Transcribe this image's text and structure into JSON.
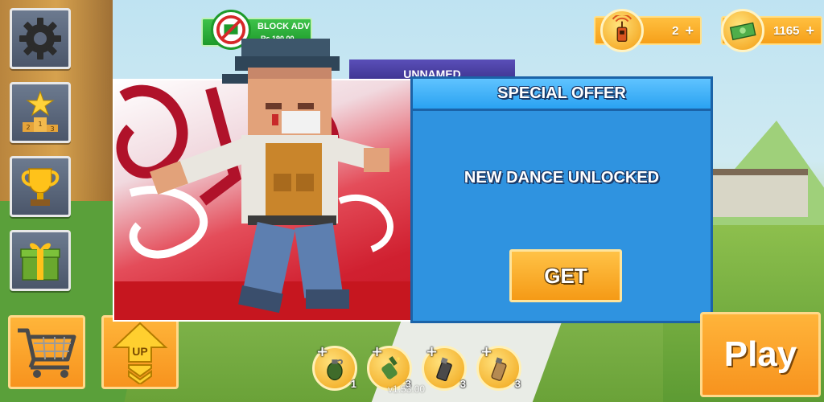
{
  "top": {
    "block_adv": {
      "title": "BLOCK ADV",
      "price": "Rs 190.00"
    },
    "signals": {
      "value": "2",
      "plus": "+"
    },
    "cash": {
      "value": "1165",
      "plus": "+"
    }
  },
  "character_panel": {
    "name_tab": "UNNAMED"
  },
  "offer_dialog": {
    "title": "SPECIAL OFFER",
    "message": "NEW DANCE UNLOCKED",
    "get_label": "GET"
  },
  "bottom": {
    "upgrade_label": "UP",
    "play_label": "Play",
    "version": "v1.53.00",
    "weapons": [
      {
        "icon": "grenade-icon",
        "count": "1",
        "plus": "+"
      },
      {
        "icon": "molotov-icon",
        "count": "3",
        "plus": "+"
      },
      {
        "icon": "smoke-grenade-icon",
        "count": "3",
        "plus": "+"
      },
      {
        "icon": "flashbang-icon",
        "count": "3",
        "plus": "+"
      }
    ]
  },
  "side_menu": [
    {
      "icon": "gear-icon"
    },
    {
      "icon": "leaderboard-icon",
      "podium": [
        "2",
        "1",
        "3"
      ]
    },
    {
      "icon": "trophy-icon"
    },
    {
      "icon": "gift-icon"
    }
  ],
  "colors": {
    "accent_orange": "#f7931e",
    "dialog_blue": "#2f93e0",
    "adv_green": "#1e9a2b",
    "tab_purple": "#3c328e"
  }
}
